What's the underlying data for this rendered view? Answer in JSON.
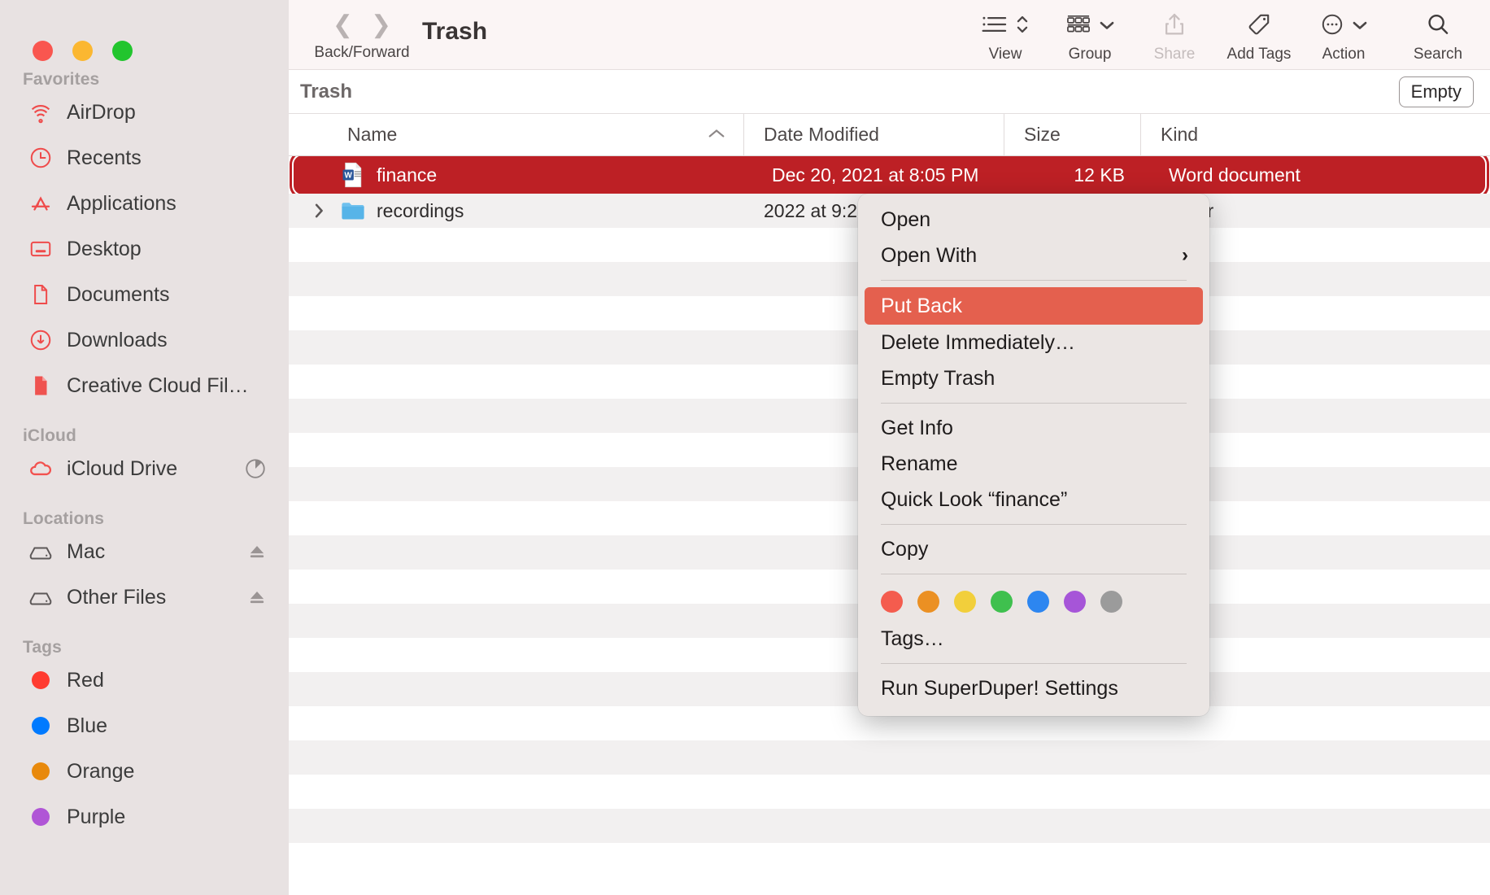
{
  "window": {
    "title": "Trash",
    "traffic_lights": [
      "close",
      "minimize",
      "maximize"
    ]
  },
  "toolbar": {
    "back_forward_label": "Back/Forward",
    "items": [
      {
        "label": "View",
        "icon": "list-view-icon",
        "dimmed": false,
        "caret": false
      },
      {
        "label": "Group",
        "icon": "group-icon",
        "dimmed": false,
        "caret": true
      },
      {
        "label": "Share",
        "icon": "share-icon",
        "dimmed": true,
        "caret": false
      },
      {
        "label": "Add Tags",
        "icon": "tag-icon",
        "dimmed": false,
        "caret": false
      },
      {
        "label": "Action",
        "icon": "ellipsis-icon",
        "dimmed": false,
        "caret": true
      },
      {
        "label": "Search",
        "icon": "search-icon",
        "dimmed": false,
        "caret": false
      }
    ]
  },
  "pathbar": {
    "title": "Trash",
    "empty_button": "Empty"
  },
  "columns": [
    {
      "key": "name",
      "label": "Name",
      "sorted": true,
      "sort_dir": "asc"
    },
    {
      "key": "date",
      "label": "Date Modified"
    },
    {
      "key": "size",
      "label": "Size"
    },
    {
      "key": "kind",
      "label": "Kind"
    }
  ],
  "files": [
    {
      "name": "finance",
      "date": "Dec 20, 2021 at 8:05 PM",
      "size": "12 KB",
      "kind": "Word document",
      "icon": "word-document-icon",
      "selected": true,
      "expandable": false
    },
    {
      "name": "recordings",
      "date": "2022 at 9:26 AM",
      "size": "--",
      "kind": "Folder",
      "icon": "folder-icon",
      "selected": false,
      "expandable": true
    }
  ],
  "sidebar": {
    "sections": [
      {
        "title": "Favorites",
        "items": [
          {
            "label": "AirDrop",
            "icon": "airdrop-icon"
          },
          {
            "label": "Recents",
            "icon": "clock-icon"
          },
          {
            "label": "Applications",
            "icon": "app-store-icon"
          },
          {
            "label": "Desktop",
            "icon": "desktop-icon"
          },
          {
            "label": "Documents",
            "icon": "document-icon"
          },
          {
            "label": "Downloads",
            "icon": "download-icon"
          },
          {
            "label": "Creative Cloud Fil…",
            "icon": "creative-cloud-file-icon"
          }
        ]
      },
      {
        "title": "iCloud",
        "items": [
          {
            "label": "iCloud Drive",
            "icon": "cloud-icon",
            "trailing": "storage-pie-icon"
          }
        ]
      },
      {
        "title": "Locations",
        "items": [
          {
            "label": "Mac",
            "icon": "drive-icon",
            "trailing": "eject-icon"
          },
          {
            "label": "Other Files",
            "icon": "drive-icon",
            "trailing": "eject-icon"
          }
        ]
      },
      {
        "title": "Tags",
        "items": [
          {
            "label": "Red",
            "icon": "tag-dot-icon",
            "color": "#ff3b30"
          },
          {
            "label": "Blue",
            "icon": "tag-dot-icon",
            "color": "#007aff"
          },
          {
            "label": "Orange",
            "icon": "tag-dot-icon",
            "color": "#e8890c"
          },
          {
            "label": "Purple",
            "icon": "tag-dot-icon",
            "color": "#b055d6"
          }
        ]
      }
    ]
  },
  "context_menu": {
    "items": [
      {
        "label": "Open",
        "type": "item"
      },
      {
        "label": "Open With",
        "type": "item",
        "submenu": true
      },
      {
        "type": "separator"
      },
      {
        "label": "Put Back",
        "type": "item",
        "highlighted": true
      },
      {
        "label": "Delete Immediately…",
        "type": "item"
      },
      {
        "label": "Empty Trash",
        "type": "item"
      },
      {
        "type": "separator"
      },
      {
        "label": "Get Info",
        "type": "item"
      },
      {
        "label": "Rename",
        "type": "item"
      },
      {
        "label": "Quick Look “finance”",
        "type": "item"
      },
      {
        "type": "separator"
      },
      {
        "label": "Copy",
        "type": "item"
      },
      {
        "type": "separator"
      },
      {
        "type": "tags"
      },
      {
        "label": "Tags…",
        "type": "item"
      },
      {
        "type": "separator"
      },
      {
        "label": "Run SuperDuper! Settings",
        "type": "item"
      }
    ],
    "tag_colors": [
      "#f45c4e",
      "#eb9023",
      "#f2cf3b",
      "#3fc04e",
      "#2d86f0",
      "#a655d8",
      "#9b9b9b"
    ],
    "submenu_arrow": "›"
  },
  "colors": {
    "selection_red": "#bd2025",
    "menu_highlight": "#e4604e",
    "sidebar_bg": "#e8e2e2",
    "toolbar_bg": "#fbf5f5",
    "accent_red": "#ef4b4b"
  }
}
